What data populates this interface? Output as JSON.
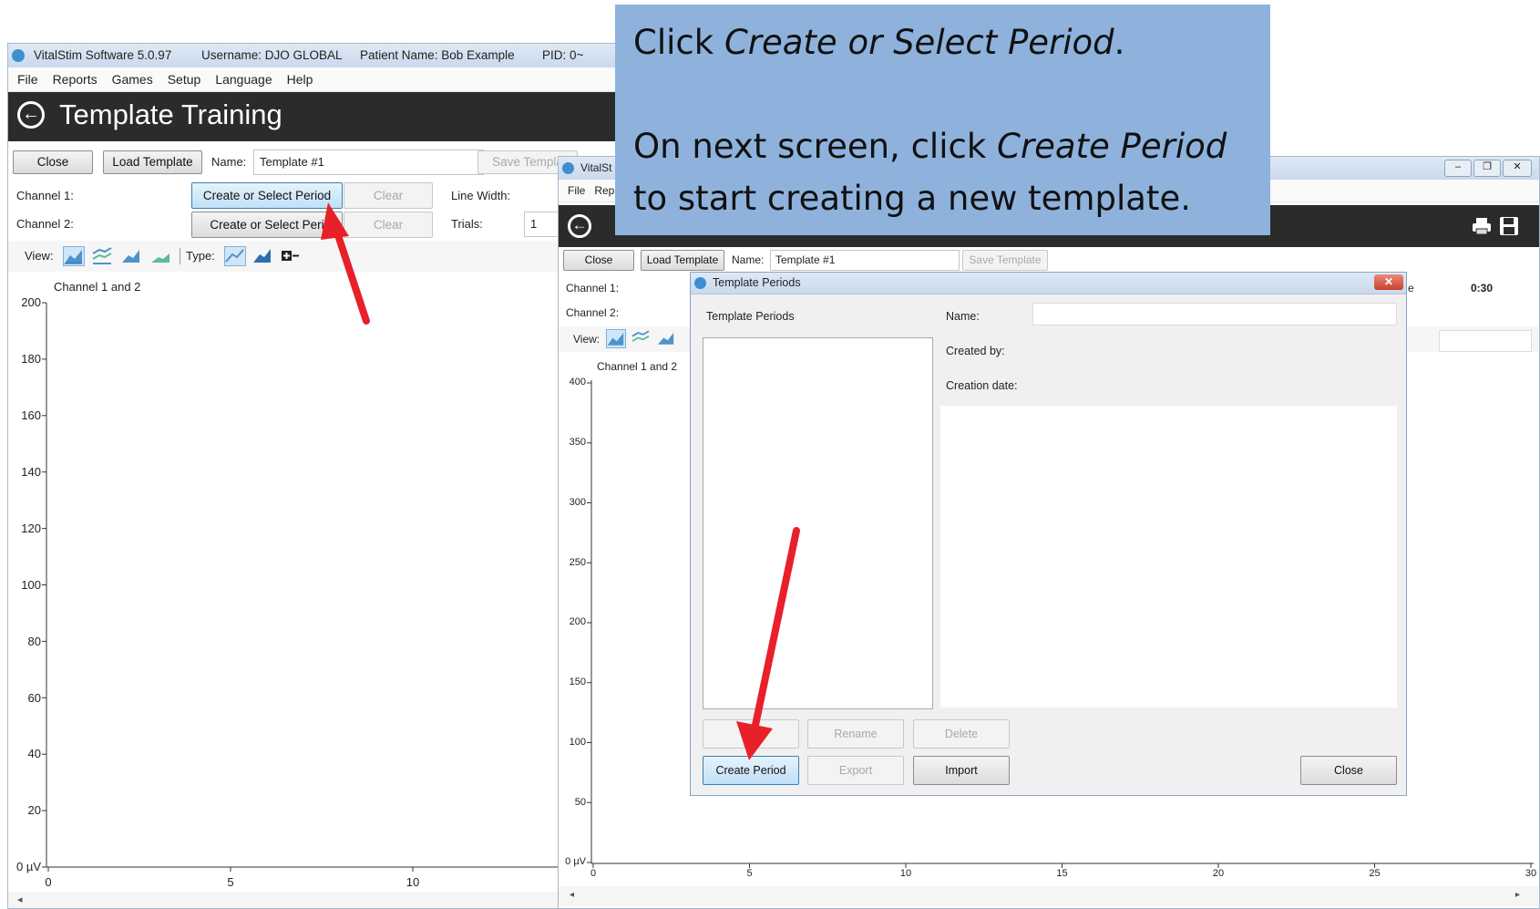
{
  "left_window": {
    "title": {
      "app": "VitalStim Software 5.0.97",
      "username": "Username: DJO GLOBAL",
      "patient": "Patient Name: Bob Example",
      "pid": "PID: 0~"
    },
    "menu": [
      "File",
      "Reports",
      "Games",
      "Setup",
      "Language",
      "Help"
    ],
    "header_title": "Template Training",
    "toolbar": {
      "close": "Close",
      "load_template": "Load Template",
      "name_label": "Name:",
      "name_value": "Template #1",
      "save_template": "Save Templa"
    },
    "channel1_label": "Channel 1:",
    "channel2_label": "Channel 2:",
    "create_select_1": "Create or Select Period",
    "create_select_2": "Create or Select Peri",
    "clear": "Clear",
    "line_width_label": "Line Width:",
    "trials_label": "Trials:",
    "trials_value": "1",
    "view_label": "View:",
    "type_label": "Type:",
    "chart_title": "Channel 1 and 2",
    "y_ticks": [
      "200",
      "180",
      "160",
      "140",
      "120",
      "100",
      "80",
      "60",
      "40",
      "20",
      "0 µV"
    ],
    "x_ticks": [
      "0",
      "5",
      "10"
    ]
  },
  "right_window": {
    "title_fragment": "VitalSt",
    "menu_fragment": [
      "File",
      "Rep"
    ],
    "toolbar": {
      "close": "Close",
      "load_template": "Load Template",
      "name_label": "Name:",
      "name_value": "Template #1",
      "save_template": "Save Template"
    },
    "channel1_label": "Channel 1:",
    "channel2_label": "Channel 2:",
    "view_label": "View:",
    "time_value": "0:30",
    "time_label_fragment": "e",
    "chart_title": "Channel 1 and 2",
    "y_ticks": [
      "400",
      "350",
      "300",
      "250",
      "200",
      "150",
      "100",
      "50",
      "0 µV"
    ],
    "x_ticks": [
      "0",
      "5",
      "10",
      "15",
      "20",
      "25",
      "30"
    ]
  },
  "dialog": {
    "title": "Template Periods",
    "list_label": "Template Periods",
    "name_label": "Name:",
    "created_by_label": "Created by:",
    "creation_date_label": "Creation date:",
    "rename": "Rename",
    "delete": "Delete",
    "create_period": "Create Period",
    "export": "Export",
    "import": "Import",
    "close": "Close"
  },
  "callout": {
    "line1_a": "Click ",
    "line1_em": "Create or Select Period",
    "line1_b": ".",
    "line2_a": "On next screen, click ",
    "line2_em": "Create Period",
    "line3": "to start creating a new template."
  },
  "colors": {
    "callout_bg": "#8eb2dc",
    "arrow": "#e8202a",
    "header_bg": "#2b2b2b",
    "highlight_btn": "#bfe0f7"
  }
}
